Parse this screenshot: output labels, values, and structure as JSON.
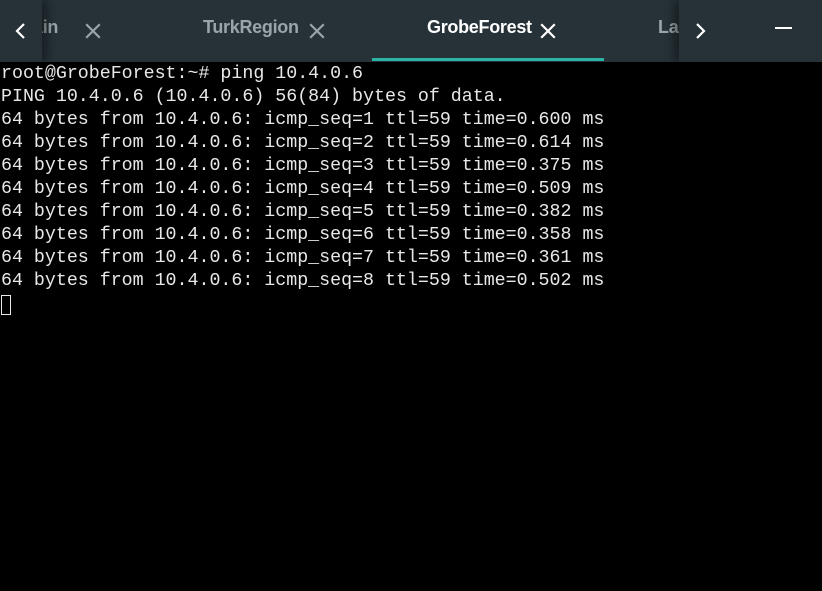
{
  "tabs": [
    {
      "label": "ain",
      "active": false,
      "closable": true
    },
    {
      "label": "TurkRegion",
      "active": false,
      "closable": true
    },
    {
      "label": "GrobeForest",
      "active": true,
      "closable": true
    },
    {
      "label": "La",
      "active": false,
      "closable": false
    }
  ],
  "nav": {
    "left_icon": "chevron-left-icon",
    "right_icon": "chevron-right-icon"
  },
  "window_controls": {
    "minimize_icon": "minimize-icon"
  },
  "colors": {
    "tabbar_bg": "#263238",
    "active_tab_text": "#ffffff",
    "inactive_tab_text": "#9aa4a9",
    "active_indicator": "#2bb3a6",
    "terminal_bg": "#000000",
    "terminal_text": "#e8e8e8"
  },
  "terminal": {
    "lines": [
      "root@GrobeForest:~# ping 10.4.0.6",
      "PING 10.4.0.6 (10.4.0.6) 56(84) bytes of data.",
      "64 bytes from 10.4.0.6: icmp_seq=1 ttl=59 time=0.600 ms",
      "64 bytes from 10.4.0.6: icmp_seq=2 ttl=59 time=0.614 ms",
      "64 bytes from 10.4.0.6: icmp_seq=3 ttl=59 time=0.375 ms",
      "64 bytes from 10.4.0.6: icmp_seq=4 ttl=59 time=0.509 ms",
      "64 bytes from 10.4.0.6: icmp_seq=5 ttl=59 time=0.382 ms",
      "64 bytes from 10.4.0.6: icmp_seq=6 ttl=59 time=0.358 ms",
      "64 bytes from 10.4.0.6: icmp_seq=7 ttl=59 time=0.361 ms",
      "64 bytes from 10.4.0.6: icmp_seq=8 ttl=59 time=0.502 ms"
    ]
  }
}
